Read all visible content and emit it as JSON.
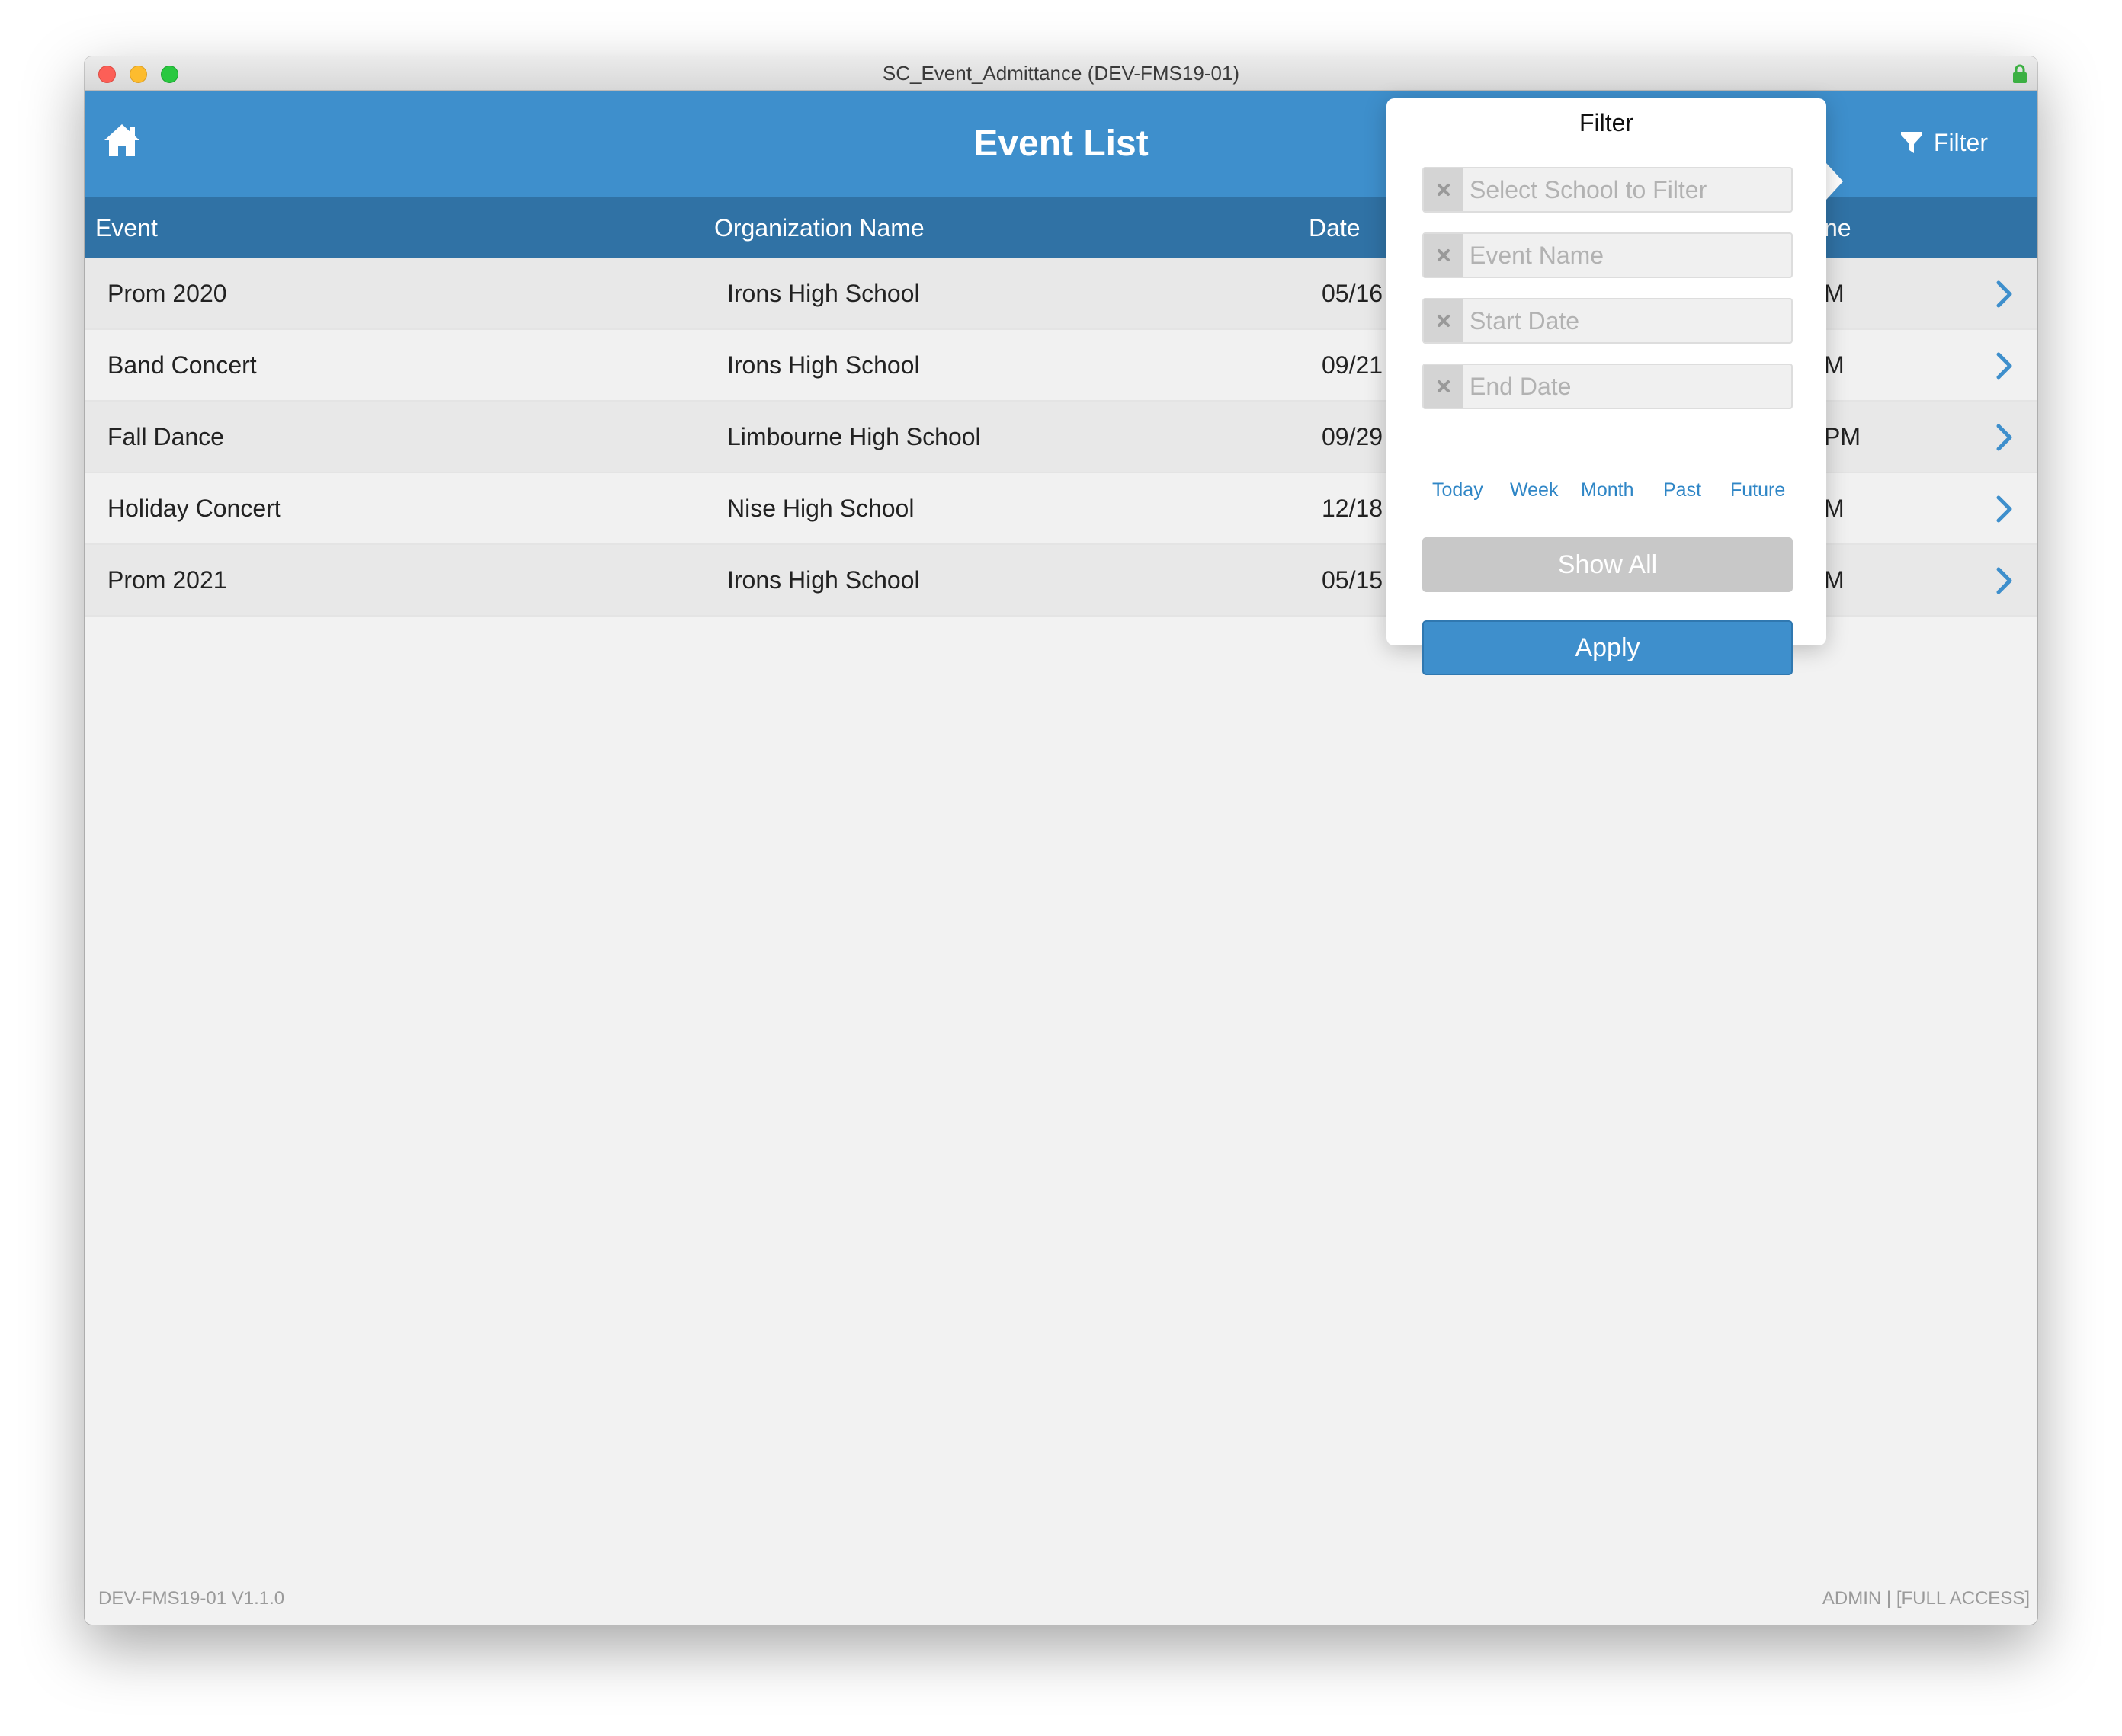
{
  "window": {
    "title": "SC_Event_Admittance (DEV-FMS19-01)"
  },
  "header": {
    "title": "Event List",
    "filter_label": "Filter"
  },
  "columns": {
    "event": "Event",
    "organization": "Organization Name",
    "date": "Date",
    "time": "ne"
  },
  "rows": [
    {
      "event": "Prom 2020",
      "organization": "Irons High School",
      "date": "05/16",
      "time": "M"
    },
    {
      "event": "Band Concert",
      "organization": "Irons High School",
      "date": "09/21",
      "time": "M"
    },
    {
      "event": "Fall Dance",
      "organization": "Limbourne High School",
      "date": "09/29",
      "time": "PM"
    },
    {
      "event": "Holiday Concert",
      "organization": "Nise High School",
      "date": "12/18",
      "time": "M"
    },
    {
      "event": "Prom 2021",
      "organization": "Irons High School",
      "date": "05/15",
      "time": "M"
    }
  ],
  "filter_popover": {
    "title": "Filter",
    "school_placeholder": "Select School to Filter",
    "event_name_placeholder": "Event Name",
    "start_date_placeholder": "Start Date",
    "end_date_placeholder": "End Date",
    "quick_ranges": [
      "Today",
      "Week",
      "Month",
      "Past",
      "Future"
    ],
    "show_all_label": "Show All",
    "apply_label": "Apply"
  },
  "footer": {
    "version": "DEV-FMS19-01 V1.1.0",
    "access": "ADMIN | [FULL ACCESS]"
  },
  "colors": {
    "header": "#3e8fcc",
    "column_header": "#3072a5",
    "accent": "#2f86c6"
  },
  "icons": [
    "home-icon",
    "filter-icon",
    "chevron-right-icon",
    "lock-icon",
    "clear-x-icon"
  ]
}
